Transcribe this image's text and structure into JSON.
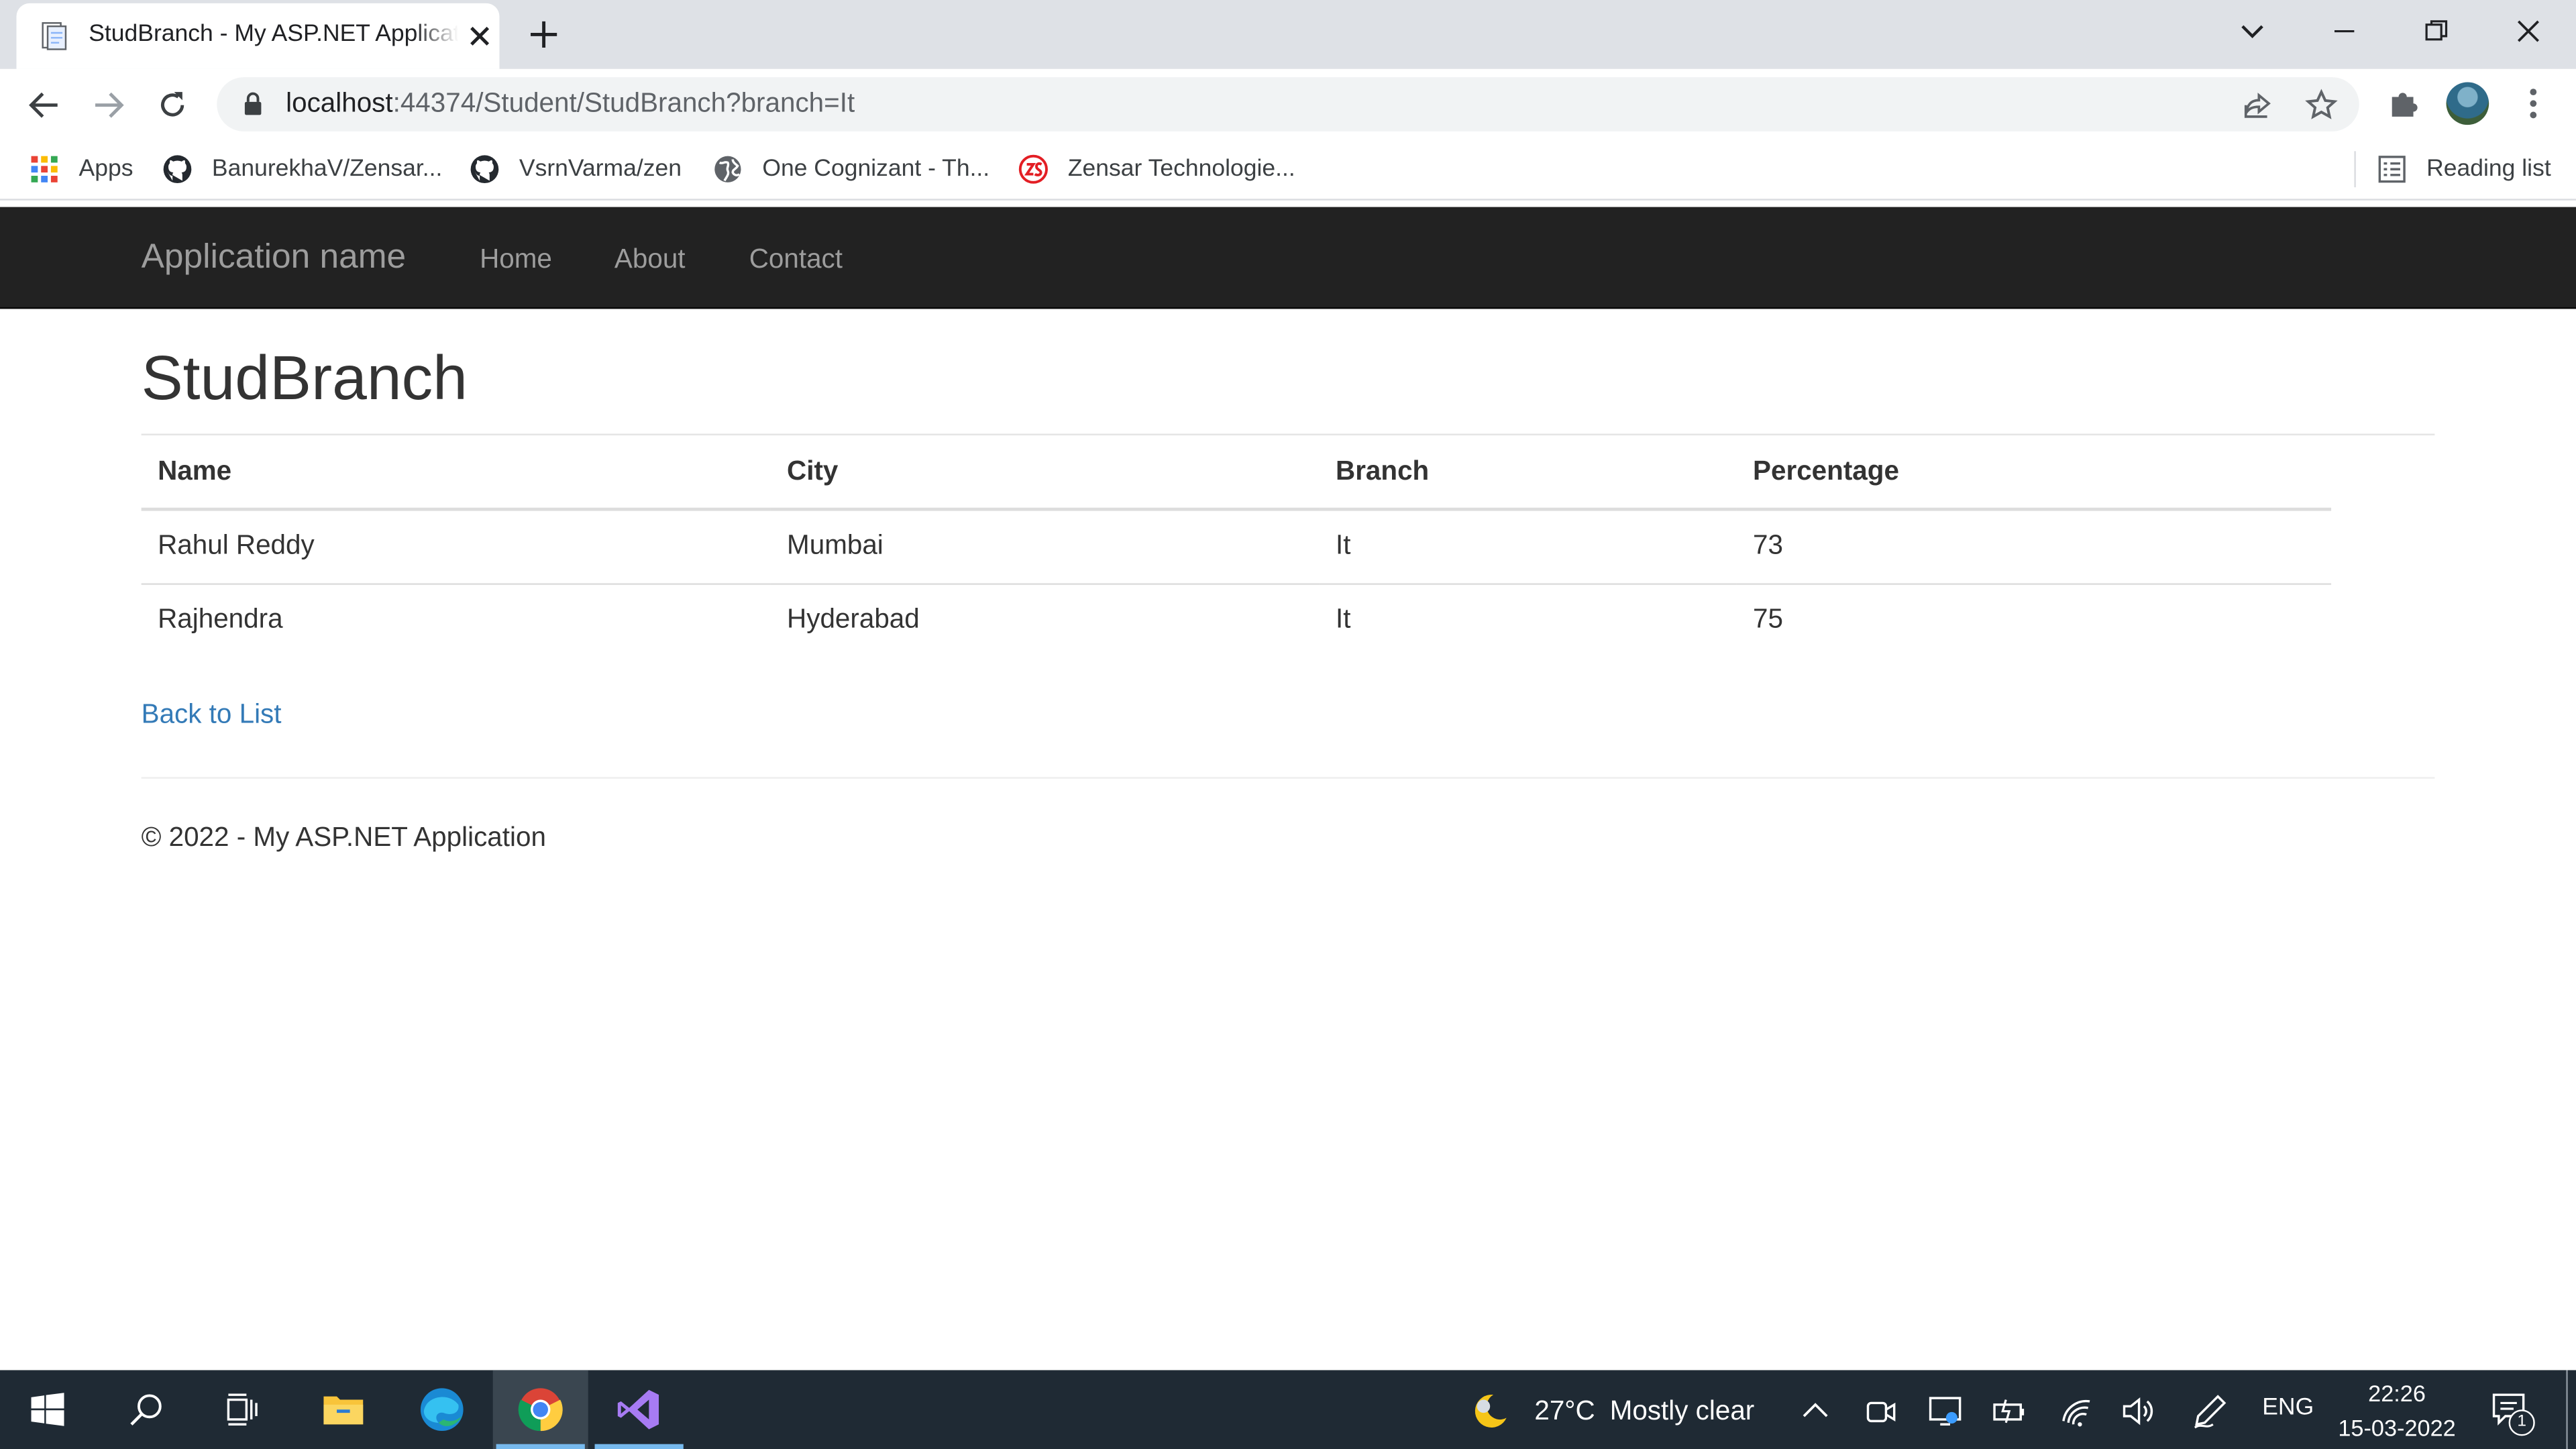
{
  "browser": {
    "tab": {
      "title": "StudBranch - My ASP.NET Application"
    },
    "address": {
      "host": "localhost",
      "path": ":44374/Student/StudBranch?branch=It"
    },
    "bookmarks": [
      {
        "label": "Apps",
        "icon": "apps-grid-icon"
      },
      {
        "label": "BanurekhaV/Zensar...",
        "icon": "github-icon"
      },
      {
        "label": "VsrnVarma/zen",
        "icon": "github-icon"
      },
      {
        "label": "One Cognizant - Th...",
        "icon": "globe-icon"
      },
      {
        "label": "Zensar Technologie...",
        "icon": "zensar-logo-icon"
      }
    ],
    "reading_list": "Reading list"
  },
  "site": {
    "brand": "Application name",
    "nav": [
      "Home",
      "About",
      "Contact"
    ]
  },
  "main": {
    "title": "StudBranch",
    "table": {
      "headers": [
        "Name",
        "City",
        "Branch",
        "Percentage"
      ],
      "rows": [
        [
          "Rahul Reddy",
          "Mumbai",
          "It",
          "73"
        ],
        [
          "Rajhendra",
          "Hyderabad",
          "It",
          "75"
        ]
      ]
    },
    "back_link": "Back to List",
    "footer": "© 2022 - My ASP.NET Application"
  },
  "taskbar": {
    "weather": {
      "temp": "27°C",
      "condition": "Mostly clear"
    },
    "language": "ENG",
    "time": "22:26",
    "date": "15-03-2022",
    "notification_count": "1"
  },
  "colors": {
    "navbar_bg": "#222222",
    "link": "#337ab7",
    "taskbar_bg": "#1f2a34"
  }
}
